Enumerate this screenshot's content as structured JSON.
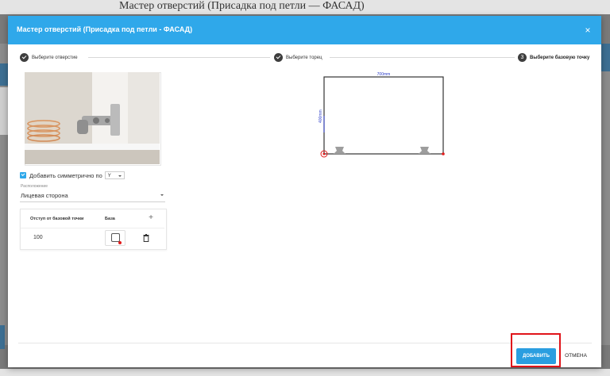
{
  "background": {
    "top_text": "Мастер отверстий (Присадка под петли — ФАСАД)"
  },
  "dialog": {
    "title": "Мастер отверстий (Присадка под петли - ФАСАД)",
    "close_icon": "×"
  },
  "stepper": {
    "steps": [
      {
        "label": "Выберите отверстие",
        "state": "done",
        "icon": "check-icon"
      },
      {
        "label": "Выберите торец",
        "state": "done",
        "icon": "check-icon"
      },
      {
        "label": "Выберите базовую точку",
        "state": "active",
        "number": "3"
      }
    ]
  },
  "form": {
    "symmetric_label": "Добавить симметрично по",
    "symmetric_axis": "Y",
    "location_label": "Расположение",
    "location_value": "Лицевая сторона"
  },
  "table": {
    "headers": [
      "Отступ от базовой точки",
      "База"
    ],
    "add_icon": "+",
    "rows": [
      {
        "offset": "100"
      }
    ]
  },
  "drawing": {
    "width_label": "700mm",
    "height_label": "400mm"
  },
  "footer": {
    "add_label": "ДОБАВИТЬ",
    "cancel_label": "ОТМЕНА"
  },
  "colors": {
    "header": "#2fa8ea",
    "accent_button": "#2a9ee0",
    "highlight": "#e0141a",
    "base_point": "#e21b1b"
  }
}
